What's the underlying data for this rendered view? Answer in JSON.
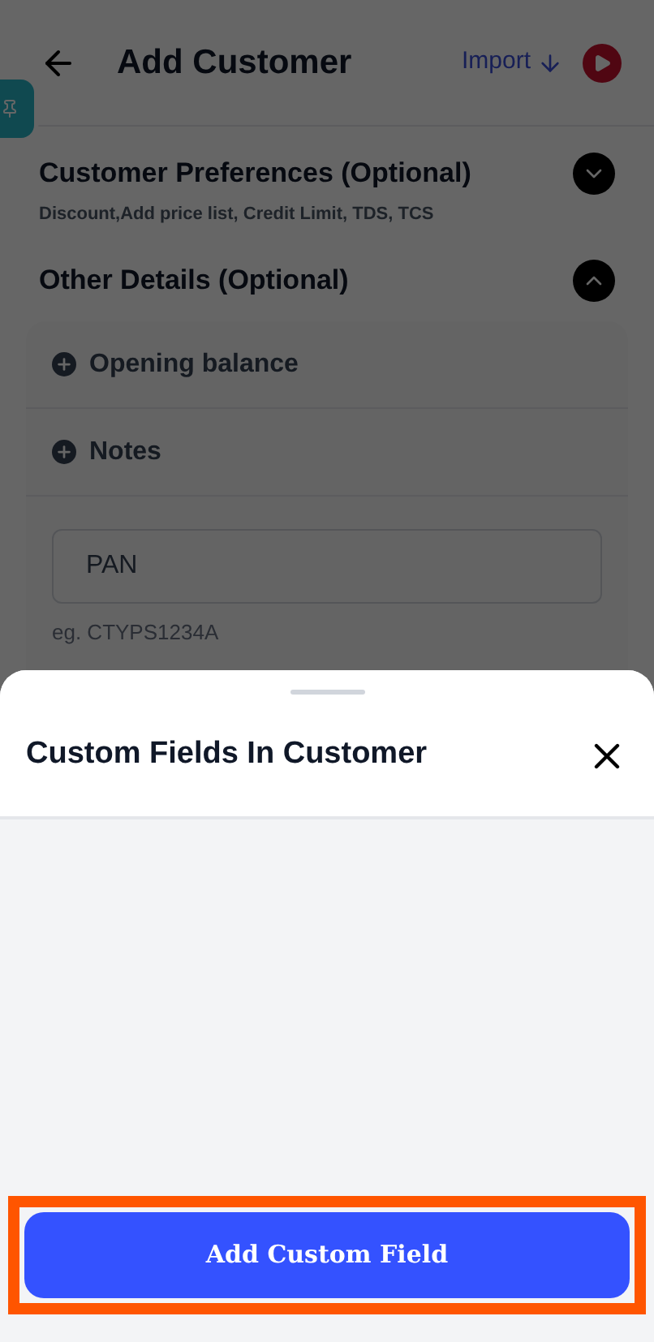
{
  "header": {
    "title": "Add Customer",
    "import_label": "Import"
  },
  "sections": [
    {
      "title": "Customer Preferences (Optional)",
      "subtitle": "Discount,Add price list, Credit Limit, TDS, TCS",
      "expanded": false
    },
    {
      "title": "Other Details (Optional)",
      "expanded": true
    }
  ],
  "other_details": {
    "items": [
      "Opening balance",
      "Notes"
    ],
    "pan_field": {
      "placeholder": "PAN",
      "hint": "eg. CTYPS1234A"
    }
  },
  "sheet": {
    "title": "Custom Fields In Customer",
    "button": "Add Custom Field",
    "button_highlighted": true
  }
}
